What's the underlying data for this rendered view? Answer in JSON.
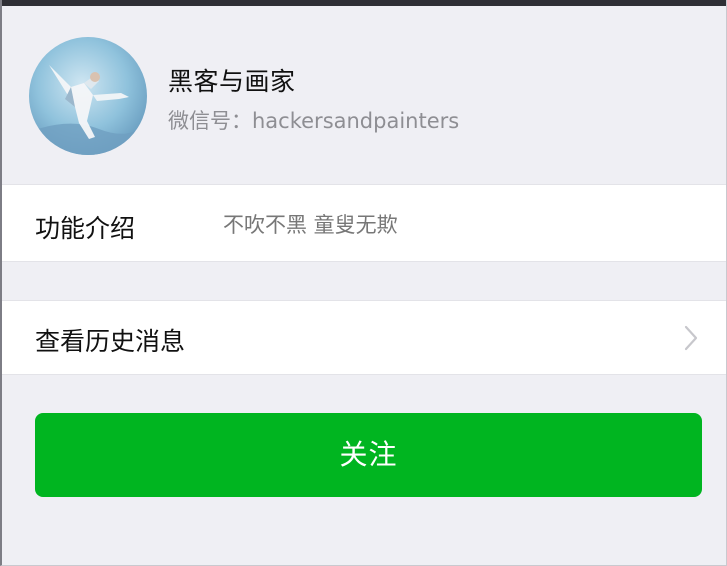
{
  "profile": {
    "name": "黑客与画家",
    "wechat_id": "微信号：hackersandpainters"
  },
  "function_intro": {
    "label": "功能介绍",
    "value": "不吹不黑 童叟无欺"
  },
  "history": {
    "label": "查看历史消息",
    "icon": "chevron-right-icon"
  },
  "follow_button": {
    "label": "关注",
    "color": "#00b520"
  },
  "colors": {
    "background": "#efeff4",
    "row_background": "#ffffff",
    "secondary_text": "#8e8e93"
  }
}
